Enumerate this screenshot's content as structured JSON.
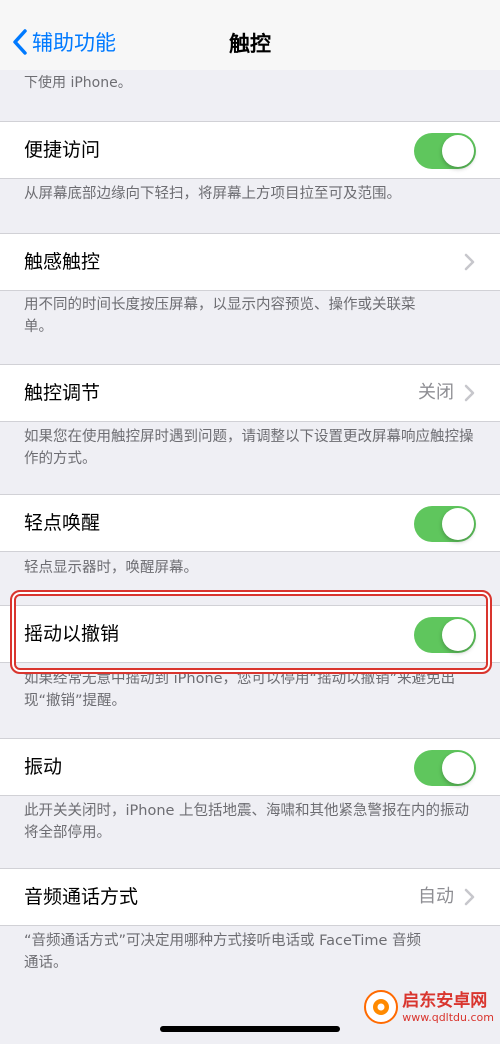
{
  "nav": {
    "back_label": "辅助功能",
    "title": "触控"
  },
  "top_note": {
    "line2": "下使用 iPhone。"
  },
  "rows": [
    {
      "label": "便捷访问",
      "toggle": true,
      "note": "从屏幕底部边缘向下轻扫，将屏幕上方项目拉至可及范围。"
    },
    {
      "label": "触感触控",
      "note": "用不同的时间长度按压屏幕，以显示内容预览、操作或关联菜单。"
    },
    {
      "label": "触控调节",
      "value": "关闭",
      "note": "如果您在使用触控屏时遇到问题，请调整以下设置更改屏幕响应触控操作的方式。"
    },
    {
      "label": "轻点唤醒",
      "toggle": true,
      "note": "轻点显示器时，唤醒屏幕。"
    },
    {
      "label": "摇动以撤销",
      "toggle": true,
      "note": "如果经常无意中摇动到 iPhone，您可以停用“摇动以撤销”来避免出现“撤销”提醒。"
    },
    {
      "label": "振动",
      "toggle": true,
      "note": "此开关关闭时，iPhone 上包括地震、海啸和其他紧急警报在内的振动将全部停用。"
    },
    {
      "label": "音频通话方式",
      "value": "自动",
      "note": "“音频通话方式”可决定用哪种方式接听电话或 FaceTime 音频通话。"
    }
  ],
  "watermark": {
    "name": "启东安卓网",
    "url": "www.qdltdu.com"
  },
  "colors": {
    "accent": "#007aff",
    "toggle_on": "#5fc65d",
    "highlight": "#d9352e"
  }
}
